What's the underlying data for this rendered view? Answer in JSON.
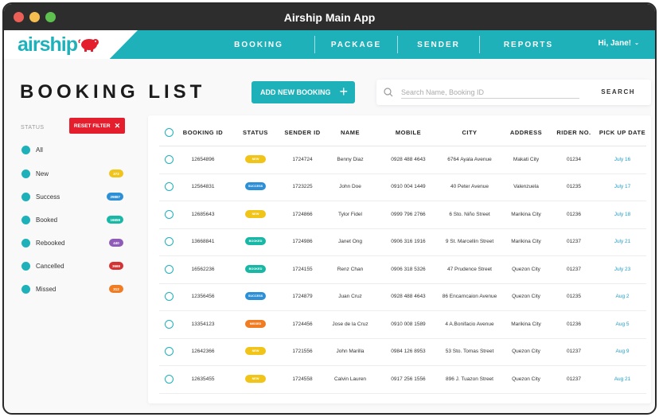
{
  "window": {
    "title": "Airship Main App"
  },
  "brand": {
    "name": "airship"
  },
  "nav": {
    "items": [
      "BOOKING",
      "PACKAGE",
      "SENDER",
      "REPORTS"
    ],
    "user": "Hi, Jane!"
  },
  "page": {
    "title": "BOOKING LIST",
    "add_button": "ADD NEW BOOKING"
  },
  "search": {
    "placeholder": "Search Name, Booking ID",
    "button": "SEARCH"
  },
  "filter": {
    "label": "STATUS",
    "reset": "RESET FILTER",
    "statuses": [
      {
        "label": "All",
        "count": "",
        "color": ""
      },
      {
        "label": "New",
        "count": "372",
        "color": "#f0c419"
      },
      {
        "label": "Success",
        "count": "29887",
        "color": "#2d8fd6"
      },
      {
        "label": "Booked",
        "count": "16659",
        "color": "#19b7a6"
      },
      {
        "label": "Rebooked",
        "count": "440",
        "color": "#8e5cb8"
      },
      {
        "label": "Cancelled",
        "count": "3669",
        "color": "#d53333"
      },
      {
        "label": "Missed",
        "count": "312",
        "color": "#f07c23"
      }
    ]
  },
  "status_colors": {
    "NEW": "#f0c419",
    "SUCCESS": "#2d8fd6",
    "BOOKED": "#19b7a6",
    "MISSED": "#f07c23"
  },
  "table": {
    "columns": [
      "BOOKING ID",
      "STATUS",
      "SENDER ID",
      "NAME",
      "MOBILE",
      "CITY",
      "ADDRESS",
      "RIDER NO.",
      "PICK UP DATE"
    ],
    "rows": [
      {
        "booking_id": "12654896",
        "status": "NEW",
        "sender_id": "1724724",
        "name": "Benny Diaz",
        "mobile": "0928 488 4643",
        "city": "6764 Ayala Avenue",
        "address": "Makati City",
        "rider": "01234",
        "date": "July 16"
      },
      {
        "booking_id": "12564831",
        "status": "SUCCESS",
        "sender_id": "1723225",
        "name": "John Doe",
        "mobile": "0910 004 1449",
        "city": "40 Peter Avenue",
        "address": "Valenzuela",
        "rider": "01235",
        "date": "July 17"
      },
      {
        "booking_id": "12685643",
        "status": "NEW",
        "sender_id": "1724866",
        "name": "Tylor Fidel",
        "mobile": "0999 796 2766",
        "city": "6 Sto. Niño Street",
        "address": "Marikina City",
        "rider": "01236",
        "date": "July 18"
      },
      {
        "booking_id": "13668841",
        "status": "BOOKED",
        "sender_id": "1724986",
        "name": "Janet Ong",
        "mobile": "0906 316 1916",
        "city": "9 St. Marcellin Street",
        "address": "Marikina City",
        "rider": "01237",
        "date": "July 21"
      },
      {
        "booking_id": "16562236",
        "status": "BOOKED",
        "sender_id": "1724155",
        "name": "Renz Chan",
        "mobile": "0906 318 5326",
        "city": "47 Prudence Street",
        "address": "Quezon City",
        "rider": "01237",
        "date": "July 23"
      },
      {
        "booking_id": "12356456",
        "status": "SUCCESS",
        "sender_id": "1724879",
        "name": "Juan Cruz",
        "mobile": "0928 488 4643",
        "city": "86 Encarncaion Avenue",
        "address": "Quezon City",
        "rider": "01235",
        "date": "Aug 2"
      },
      {
        "booking_id": "13354123",
        "status": "MISSED",
        "sender_id": "1724456",
        "name": "Jose de la Cruz",
        "mobile": "0910 008 1589",
        "city": "4 A.Bonifacio Avenue",
        "address": "Marikina City",
        "rider": "01236",
        "date": "Aug 5"
      },
      {
        "booking_id": "12642366",
        "status": "NEW",
        "sender_id": "1721556",
        "name": "John Marilla",
        "mobile": "0984 126 8953",
        "city": "53 Sto. Tomas Street",
        "address": "Quezon City",
        "rider": "01237",
        "date": "Aug 9"
      },
      {
        "booking_id": "12635455",
        "status": "NEW",
        "sender_id": "1724558",
        "name": "Calvin Lauren",
        "mobile": "0917 256 1556",
        "city": "896 J. Tuazon Street",
        "address": "Quezon City",
        "rider": "01237",
        "date": "Aug 21"
      }
    ]
  }
}
